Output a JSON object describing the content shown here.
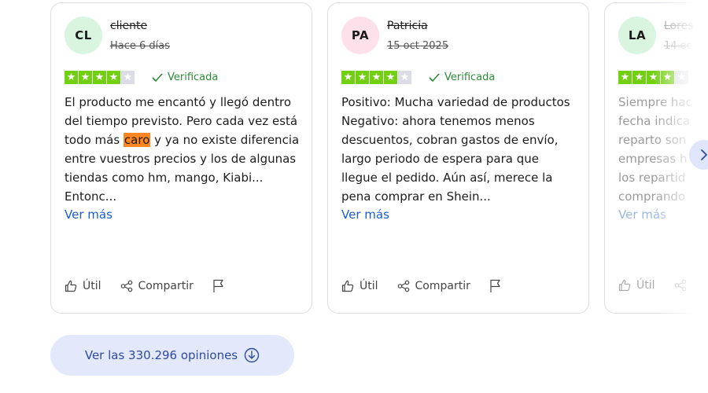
{
  "reviews": [
    {
      "initials": "CL",
      "avatar_color": "#d9f5df",
      "name": "cliente",
      "date": "Hace 6 días",
      "rating": 4,
      "verified": "Verificada",
      "text_before": "El producto me encantó y llegó dentro del tiempo previsto. Pero cada vez está todo más ",
      "text_highlight": "caro",
      "text_after": " y ya no existe diferencia entre vuestros precios y los de algunas tiendas como hm, mango, Kiabi... Entonc...",
      "more": "Ver más",
      "useful": "Útil",
      "share": "Compartir"
    },
    {
      "initials": "PA",
      "avatar_color": "#fde0ea",
      "name": "Patricia",
      "date": "15 oct 2025",
      "rating": 4,
      "verified": "Verificada",
      "text_before": "Positivo: Mucha variedad de productos Negativo: ahora tenemos menos descuentos, cobran gastos de envío, largo periodo de espera para que llegue el pedido. Aún así, merece la pena comprar en Shein...",
      "text_highlight": "",
      "text_after": "",
      "more": "Ver más",
      "useful": "Útil",
      "share": "Compartir"
    },
    {
      "initials": "LA",
      "avatar_color": "#d9f5df",
      "name": "Lores",
      "date": "14 oc",
      "rating": 4,
      "verified": "",
      "text_before": "Siempre hac fecha indica reparto son empresas h los repartid comprando",
      "text_highlight": "",
      "text_after": "",
      "more": "Ver más",
      "useful": "Útil",
      "share": ""
    }
  ],
  "see_all_label": "Ver las 330.296 opiniones",
  "colors": {
    "star_on": "#73cf11",
    "star_off": "#dcdce6",
    "verified": "#2c8a39",
    "link": "#1a5cc8",
    "highlight": "#ff8622",
    "button_bg": "#e3e9fb"
  },
  "icons": {
    "verified": "check-icon",
    "useful": "thumbs-up-icon",
    "share": "share-icon",
    "report": "flag-icon",
    "next": "chevron-right-icon",
    "see_all": "arrow-down-circle-icon"
  }
}
